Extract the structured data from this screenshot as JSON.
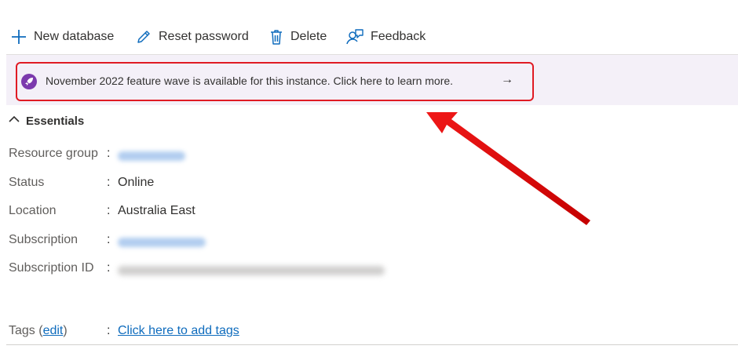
{
  "toolbar": {
    "new_database": "New database",
    "reset_password": "Reset password",
    "delete": "Delete",
    "feedback": "Feedback"
  },
  "banner": {
    "text": "November 2022 feature wave is available for this instance. Click here to learn more.",
    "arrow": "→",
    "icon": "rocket-icon",
    "icon_color": "#7c3aad",
    "highlight_color": "#e01b24"
  },
  "essentials": {
    "title": "Essentials",
    "rows": [
      {
        "label": "Resource group",
        "value": ""
      },
      {
        "label": "Status",
        "value": "Online"
      },
      {
        "label": "Location",
        "value": "Australia East"
      },
      {
        "label": "Subscription",
        "value": ""
      },
      {
        "label": "Subscription ID",
        "value": ""
      }
    ],
    "tags": {
      "label_prefix": "Tags (",
      "edit": "edit",
      "label_suffix": ")",
      "add_tags": "Click here to add tags"
    }
  },
  "colors": {
    "accent_blue": "#0f6cbd",
    "banner_bg": "#f4f0f8",
    "annotation_red": "#e01b24"
  }
}
